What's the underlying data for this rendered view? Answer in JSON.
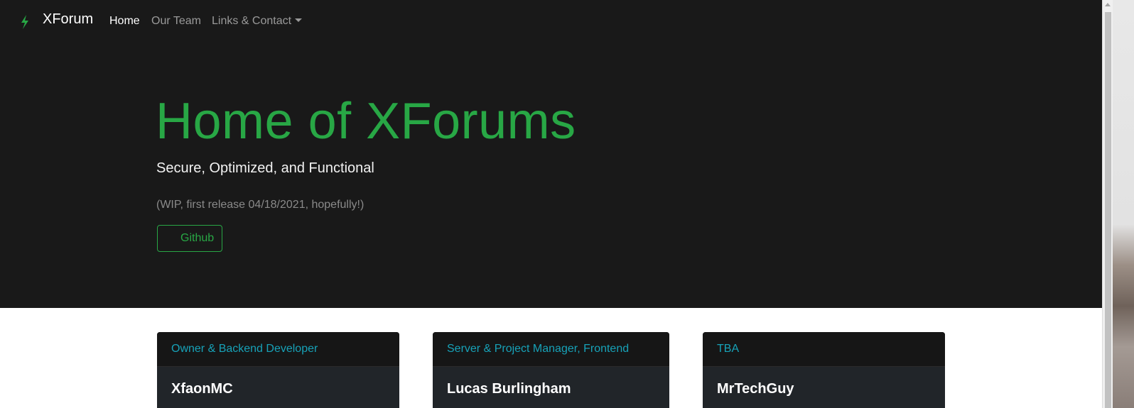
{
  "navbar": {
    "brand": "XForum",
    "brand_icon": "bolt-icon",
    "links": {
      "home": "Home",
      "team": "Our Team",
      "contact": "Links & Contact"
    }
  },
  "hero": {
    "title": "Home of XForums",
    "subtitle": "Secure, Optimized, and Functional",
    "note": "(WIP, first release 04/18/2021, hopefully!)",
    "button_label": "Github"
  },
  "team": [
    {
      "role": "Owner & Backend Developer",
      "name": "XfaonMC"
    },
    {
      "role": "Server & Project Manager, Frontend",
      "name": "Lucas Burlingham"
    },
    {
      "role": "TBA",
      "name": "MrTechGuy"
    }
  ],
  "colors": {
    "accent": "#28a745",
    "role_text": "#17a2b8",
    "dark_bg": "#191919"
  }
}
